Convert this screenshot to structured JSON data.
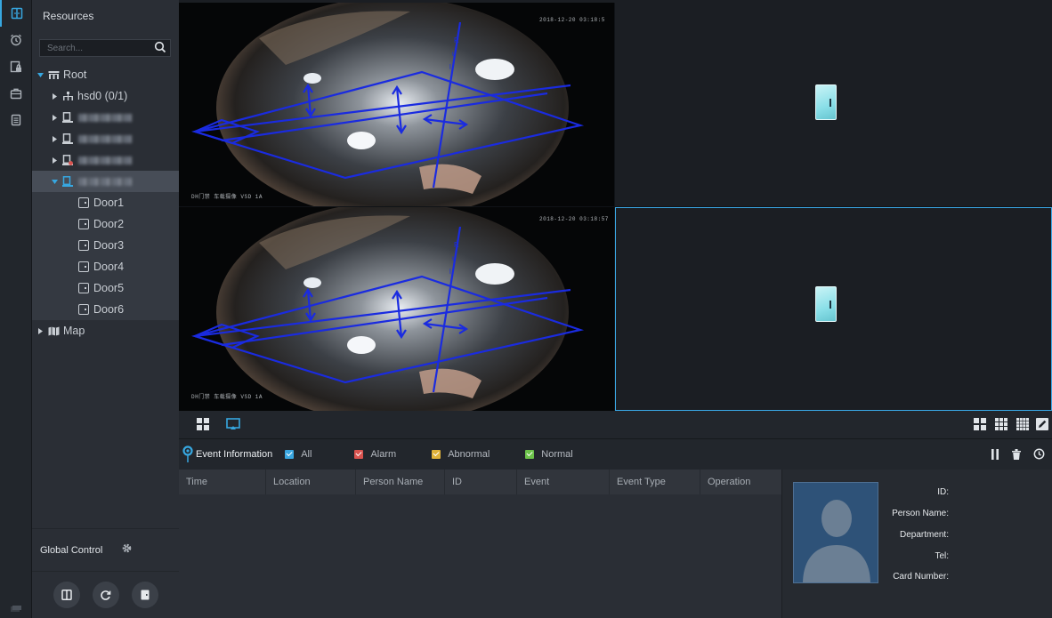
{
  "sidebar_rail": {
    "items": [
      {
        "name": "access-control",
        "icon": "door-split-icon"
      },
      {
        "name": "alarm",
        "icon": "alarm-clock-icon"
      },
      {
        "name": "device-lock",
        "icon": "device-lock-icon"
      },
      {
        "name": "briefcase",
        "icon": "briefcase-icon"
      },
      {
        "name": "logs",
        "icon": "document-icon"
      }
    ]
  },
  "resources": {
    "title": "Resources",
    "search_placeholder": "Search...",
    "root_label": "Root",
    "hsd_label": "hsd0 (0/1)",
    "doors": [
      "Door1",
      "Door2",
      "Door3",
      "Door4",
      "Door5",
      "Door6"
    ],
    "map_label": "Map"
  },
  "global_control": {
    "label": "Global Control"
  },
  "video": {
    "cam1_timestamp": "2018-12-20 03:18:5",
    "cam1_caption": "DH门禁 车载摄像 VSD 1A",
    "cam2_timestamp": "2018-12-20 03:18:57",
    "cam2_caption": "DH门禁 车载摄像 VSD 1A"
  },
  "events": {
    "title": "Event Information",
    "filters": [
      {
        "label": "All",
        "color": "#39a6e0"
      },
      {
        "label": "Alarm",
        "color": "#d9534f"
      },
      {
        "label": "Abnormal",
        "color": "#e0b23a"
      },
      {
        "label": "Normal",
        "color": "#6cc24a"
      }
    ],
    "columns": [
      "Time",
      "Location",
      "Person Name",
      "ID",
      "Event",
      "Event Type",
      "Operation"
    ]
  },
  "person_info": {
    "id_label": "ID:",
    "name_label": "Person Name:",
    "department_label": "Department:",
    "tel_label": "Tel:",
    "card_label": "Card Number:"
  },
  "colors": {
    "accent": "#37a7e0",
    "overlay_lines": "#1a2be0",
    "door_icon": "#8adfe8"
  }
}
